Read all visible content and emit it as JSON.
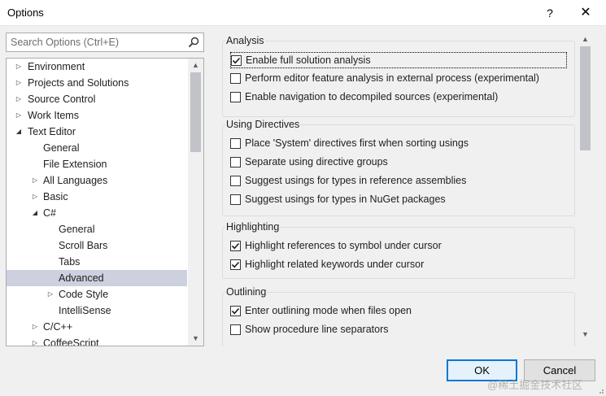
{
  "window": {
    "title": "Options",
    "help_label": "?",
    "close_label": "✕"
  },
  "search": {
    "placeholder": "Search Options (Ctrl+E)",
    "value": ""
  },
  "tree": {
    "items": [
      {
        "label": "Environment",
        "level": 0,
        "arrow": "▷"
      },
      {
        "label": "Projects and Solutions",
        "level": 0,
        "arrow": "▷"
      },
      {
        "label": "Source Control",
        "level": 0,
        "arrow": "▷"
      },
      {
        "label": "Work Items",
        "level": 0,
        "arrow": "▷"
      },
      {
        "label": "Text Editor",
        "level": 0,
        "arrow": "◢"
      },
      {
        "label": "General",
        "level": 1,
        "arrow": ""
      },
      {
        "label": "File Extension",
        "level": 1,
        "arrow": ""
      },
      {
        "label": "All Languages",
        "level": 1,
        "arrow": "▷"
      },
      {
        "label": "Basic",
        "level": 1,
        "arrow": "▷"
      },
      {
        "label": "C#",
        "level": 1,
        "arrow": "◢"
      },
      {
        "label": "General",
        "level": 2,
        "arrow": ""
      },
      {
        "label": "Scroll Bars",
        "level": 2,
        "arrow": ""
      },
      {
        "label": "Tabs",
        "level": 2,
        "arrow": ""
      },
      {
        "label": "Advanced",
        "level": 2,
        "arrow": "",
        "selected": true
      },
      {
        "label": "Code Style",
        "level": 2,
        "arrow": "▷"
      },
      {
        "label": "IntelliSense",
        "level": 2,
        "arrow": ""
      },
      {
        "label": "C/C++",
        "level": 1,
        "arrow": "▷"
      },
      {
        "label": "CoffeeScript",
        "level": 1,
        "arrow": "▷"
      }
    ]
  },
  "groups": [
    {
      "header": "Analysis",
      "options": [
        {
          "label": "Enable full solution analysis",
          "checked": true,
          "focused": true
        },
        {
          "label": "Perform editor feature analysis in external process (experimental)",
          "checked": false
        },
        {
          "label": "Enable navigation to decompiled sources (experimental)",
          "checked": false
        }
      ]
    },
    {
      "header": "Using Directives",
      "options": [
        {
          "label": "Place 'System' directives first when sorting usings",
          "checked": false
        },
        {
          "label": "Separate using directive groups",
          "checked": false
        },
        {
          "label": "Suggest usings for types in reference assemblies",
          "checked": false
        },
        {
          "label": "Suggest usings for types in NuGet packages",
          "checked": false
        }
      ]
    },
    {
      "header": "Highlighting",
      "options": [
        {
          "label": "Highlight references to symbol under cursor",
          "checked": true
        },
        {
          "label": "Highlight related keywords under cursor",
          "checked": true
        }
      ]
    },
    {
      "header": "Outlining",
      "options": [
        {
          "label": "Enter outlining mode when files open",
          "checked": true
        },
        {
          "label": "Show procedure line separators",
          "checked": false
        }
      ]
    }
  ],
  "buttons": {
    "ok": "OK",
    "cancel": "Cancel"
  },
  "watermark": "@稀土掘金技术社区",
  "colors": {
    "selection": "#cdd0df",
    "ok_border": "#0078d7"
  }
}
